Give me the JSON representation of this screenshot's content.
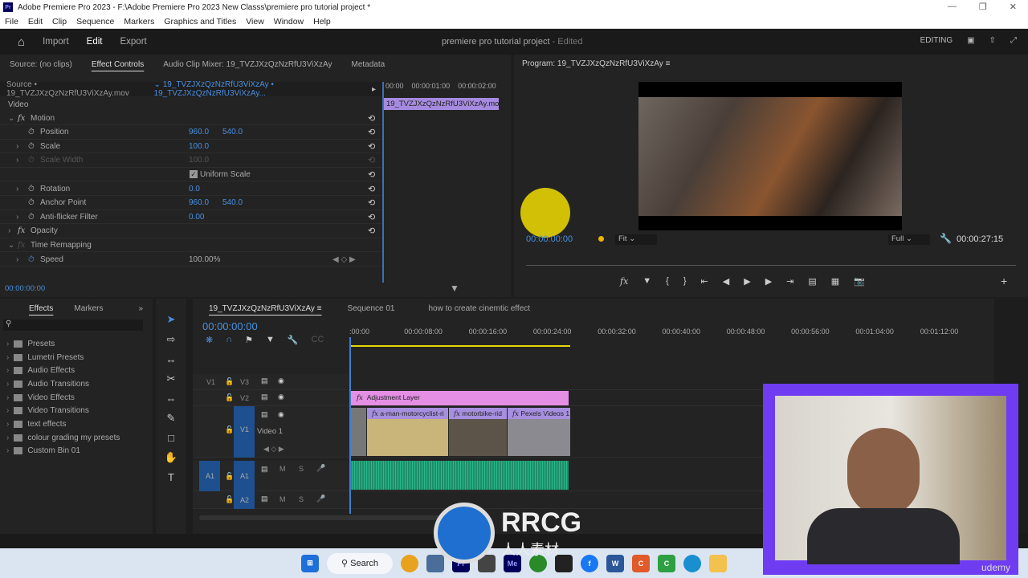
{
  "window": {
    "title": "Adobe Premiere Pro 2023 - F:\\Adobe Premiere Pro 2023 New Classs\\premiere pro tutorial project *",
    "logo": "Pr"
  },
  "menu": [
    "File",
    "Edit",
    "Clip",
    "Sequence",
    "Markers",
    "Graphics and Titles",
    "View",
    "Window",
    "Help"
  ],
  "header": {
    "nav": [
      "Import",
      "Edit",
      "Export"
    ],
    "active": "Edit",
    "project": "premiere pro tutorial project",
    "edited": "- Edited",
    "workspace": "EDITING"
  },
  "effect_controls": {
    "tabs": [
      "Source: (no clips)",
      "Effect Controls",
      "Audio Clip Mixer: 19_TVZJXzQzNzRfU3ViXzAy",
      "Metadata"
    ],
    "source": "Source • 19_TVZJXzQzNzRfU3ViXzAy.mov",
    "sequence_clip": "19_TVZJXzQzNzRfU3ViXzAy • 19_TVZJXzQzNzRfU3ViXzAy...",
    "ruler": [
      "00:00",
      "00:00:01:00",
      "00:00:02:00"
    ],
    "clip_name": "19_TVZJXzQzNzRfU3ViXzAy.mov",
    "section": "Video",
    "rows": [
      {
        "label": "Motion",
        "fx": true,
        "v1": "",
        "v2": ""
      },
      {
        "label": "Position",
        "v1": "960.0",
        "v2": "540.0"
      },
      {
        "label": "Scale",
        "v1": "100.0",
        "v2": ""
      },
      {
        "label": "Scale Width",
        "v1": "100.0",
        "v2": "",
        "disabled": true
      },
      {
        "label": "Uniform Scale",
        "checkbox": true,
        "v1": "",
        "v2": ""
      },
      {
        "label": "Rotation",
        "v1": "0.0",
        "v2": ""
      },
      {
        "label": "Anchor Point",
        "v1": "960.0",
        "v2": "540.0"
      },
      {
        "label": "Anti-flicker Filter",
        "v1": "0.00",
        "v2": ""
      },
      {
        "label": "Opacity",
        "fx": true,
        "v1": "",
        "v2": ""
      },
      {
        "label": "Time Remapping",
        "fx": true,
        "v1": "",
        "v2": ""
      },
      {
        "label": "Speed",
        "v1": "100.00%",
        "v2": ""
      }
    ],
    "timecode": "00:00:00:00"
  },
  "program": {
    "title": "Program: 19_TVZJXzQzNzRfU3ViXzAy",
    "timecode": "00:00:00:00",
    "fit": "Fit",
    "quality": "Full",
    "duration": "00:00:27:15"
  },
  "effects_panel": {
    "tabs": [
      "Effects",
      "Markers"
    ],
    "items": [
      "Presets",
      "Lumetri Presets",
      "Audio Effects",
      "Audio Transitions",
      "Video Effects",
      "Video Transitions",
      "text effects",
      "colour grading my presets",
      "Custom Bin 01"
    ]
  },
  "timeline": {
    "tabs": [
      "19_TVZJXzQzNzRfU3ViXzAy",
      "Sequence 01",
      "how to create cinemtic effect"
    ],
    "timecode": "00:00:00:00",
    "ruler": [
      ":00:00",
      "00:00:08:00",
      "00:00:16:00",
      "00:00:24:00",
      "00:00:32:00",
      "00:00:40:00",
      "00:00:48:00",
      "00:00:56:00",
      "00:01:04:00",
      "00:01:12:00"
    ],
    "tracks": {
      "v3": "V3",
      "v2": "V2",
      "v1": "V1",
      "v1_name": "Video 1",
      "src_v": "V1",
      "a1": "A1",
      "src_a": "A1",
      "a2": "A2"
    },
    "clips": {
      "adjustment": "Adjustment Layer",
      "c1": "a-man-motorcyclist-ri",
      "c2": "motorbike-rid",
      "c3": "Pexels Videos 1"
    }
  },
  "taskbar": {
    "search": "Search"
  },
  "watermark": {
    "text": "RRCG",
    "sub": "人人素材",
    "udemy": "udemy"
  }
}
